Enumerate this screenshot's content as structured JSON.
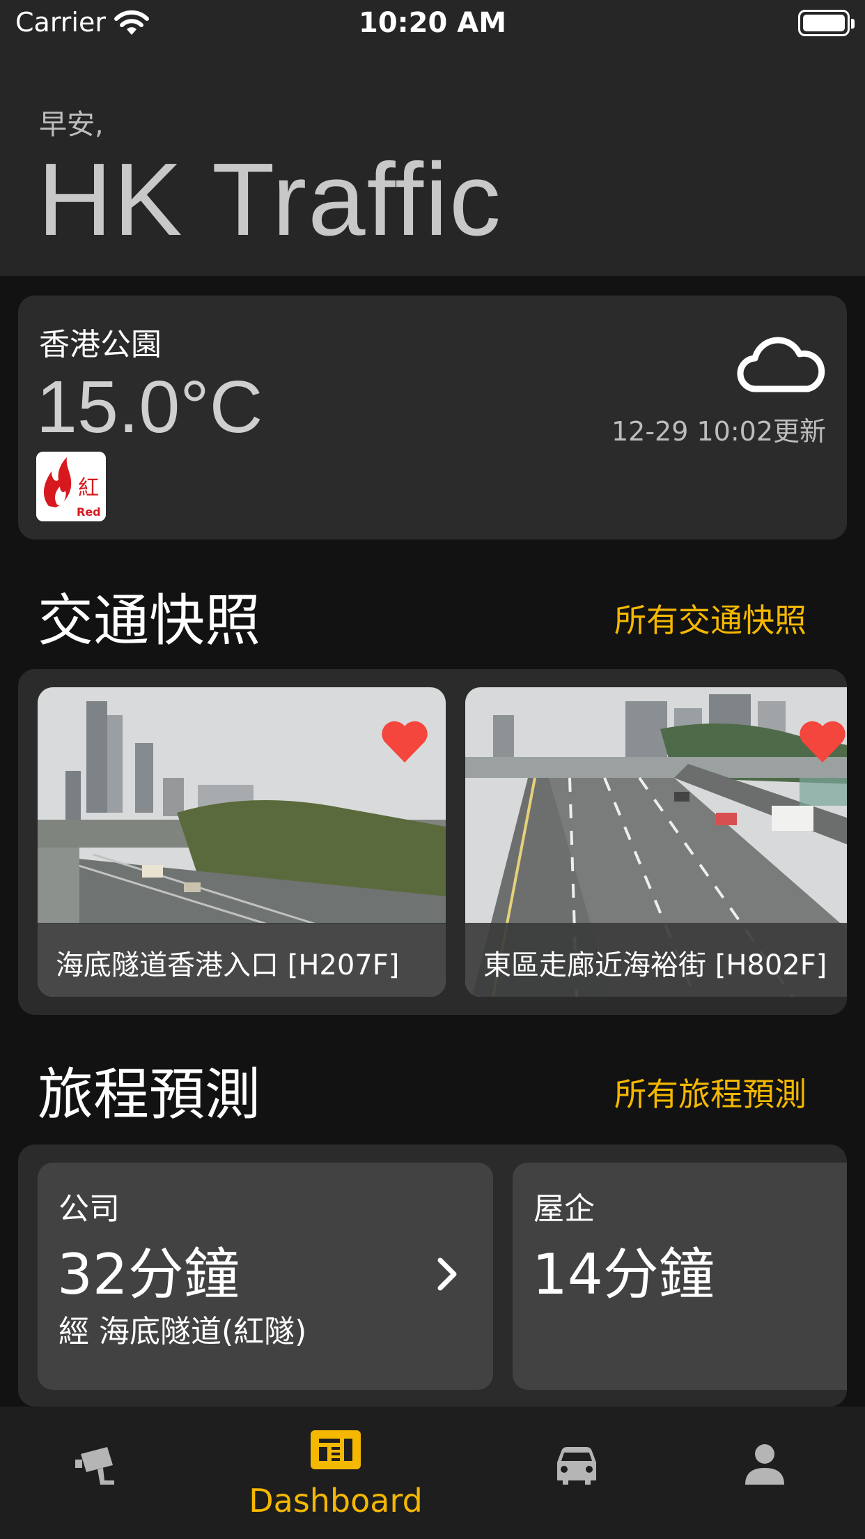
{
  "status_bar": {
    "carrier": "Carrier",
    "time": "10:20 AM"
  },
  "header": {
    "greeting": "早安,",
    "title": "HK Traffic"
  },
  "weather": {
    "location": "香港公園",
    "temperature": "15.0°C",
    "updated": "12-29 10:02更新",
    "condition_icon": "cloud-icon",
    "warning_icon": "fire-danger-red-icon"
  },
  "snapshots": {
    "section_title": "交通快照",
    "view_all": "所有交通快照",
    "items": [
      {
        "caption": "海底隧道香港入口 [H207F]",
        "favorite": true
      },
      {
        "caption": "東區走廊近海裕街 [H802F]",
        "favorite": true
      }
    ]
  },
  "trips": {
    "section_title": "旅程預測",
    "view_all": "所有旅程預測",
    "items": [
      {
        "name": "公司",
        "time": "32分鐘",
        "via": "經 海底隧道(紅隧)"
      },
      {
        "name": "屋企",
        "time": "14分鐘"
      }
    ]
  },
  "tab_bar": {
    "active_label": "Dashboard",
    "accent": "#f5b800",
    "tabs": [
      "camera-icon",
      "dashboard-icon",
      "car-icon",
      "person-icon"
    ]
  }
}
